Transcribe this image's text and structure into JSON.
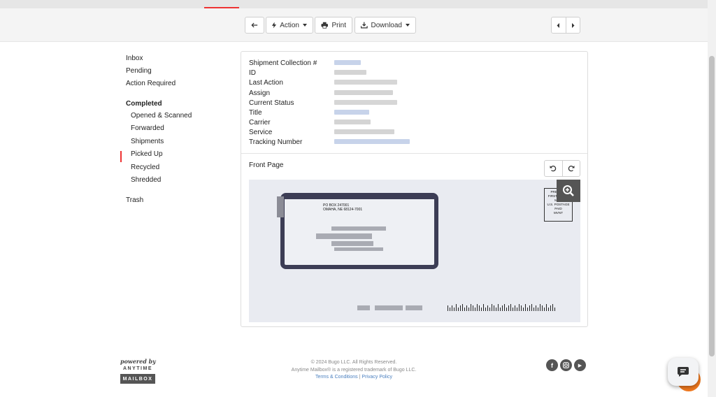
{
  "toolbar": {
    "action_label": "Action",
    "print_label": "Print",
    "download_label": "Download"
  },
  "sidebar": {
    "items": [
      {
        "label": "Inbox"
      },
      {
        "label": "Pending"
      },
      {
        "label": "Action Required"
      },
      {
        "label": "Completed"
      },
      {
        "label": "Opened & Scanned"
      },
      {
        "label": "Forwarded"
      },
      {
        "label": "Shipments"
      },
      {
        "label": "Picked Up"
      },
      {
        "label": "Recycled"
      },
      {
        "label": "Shredded"
      },
      {
        "label": "Trash"
      }
    ],
    "active": "Completed"
  },
  "details": {
    "fields": [
      {
        "label": "Shipment Collection #"
      },
      {
        "label": "ID"
      },
      {
        "label": "Last Action"
      },
      {
        "label": "Assign"
      },
      {
        "label": "Current Status"
      },
      {
        "label": "Title"
      },
      {
        "label": "Carrier"
      },
      {
        "label": "Service"
      },
      {
        "label": "Tracking Number"
      }
    ]
  },
  "scan": {
    "label": "Front Page",
    "envelope_return_line1": "PO BOX 247001",
    "envelope_return_line2": "OMAHA, NE 68124-7001",
    "stamp_line1": "PRESORT",
    "stamp_line2": "FIRST CLASS",
    "stamp_line3": "MAIL",
    "stamp_line4": "U.S. POSTAGE",
    "stamp_line5": "PAID",
    "stamp_line6": "MVNT"
  },
  "footer": {
    "powered_by": "powered by",
    "brand_top": "ANYTIME",
    "brand_bottom": "MAILBOX",
    "copyright": "© 2024 Bugo LLC. All Rights Reserved.",
    "trademark": "Anytime Mailbox® is a registered trademark of Bugo LLC.",
    "terms": "Terms & Conditions",
    "separator": "|",
    "privacy": "Privacy Policy",
    "facebook_glyph": "f",
    "youtube_glyph": "▶"
  },
  "colors": {
    "accent": "#e33333",
    "chat": "#f0791f",
    "link": "#4a7fbf"
  }
}
